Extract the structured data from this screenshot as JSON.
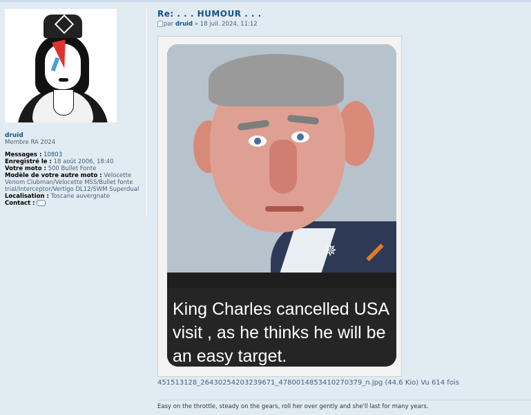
{
  "profile": {
    "username": "druid",
    "rank": "Membre RA 2024",
    "messages_label": "Messages :",
    "messages_value": "10803",
    "registered_label": "Enregistré le :",
    "registered_value": "18 août 2006, 18:40",
    "moto_label": "Votre moto :",
    "moto_value": "500 Bullet Fonte",
    "other_moto_label": "Modèle de votre autre moto :",
    "other_moto_value": "Velocette Venom Clubman/Velocette MSS/Bullet fonte trial/Interceptor/Vertigo DL12/SWM Superdual",
    "location_label": "Localisation :",
    "location_value": "Toscane auvergnate",
    "contact_label": "Contact :"
  },
  "post": {
    "title": "Re: . . . HUMOUR . . .",
    "by_label": "par",
    "author": "druid",
    "date": "» 18 juil. 2024, 11:12",
    "image_caption": "King Charles cancelled USA visit , as he thinks he will be an easy target.",
    "attachment": "451513128_26430254203239671_4780014853410270379_n.jpg (44.6 Kio) Vu 614 fois",
    "signature": "Easy on the throttle, steady on the gears, roll her over gently and she'll last for many years."
  },
  "icons": [
    "post-icon",
    "contact-icon"
  ],
  "colors": {
    "background": "#e1ebf2",
    "link": "#105289"
  }
}
